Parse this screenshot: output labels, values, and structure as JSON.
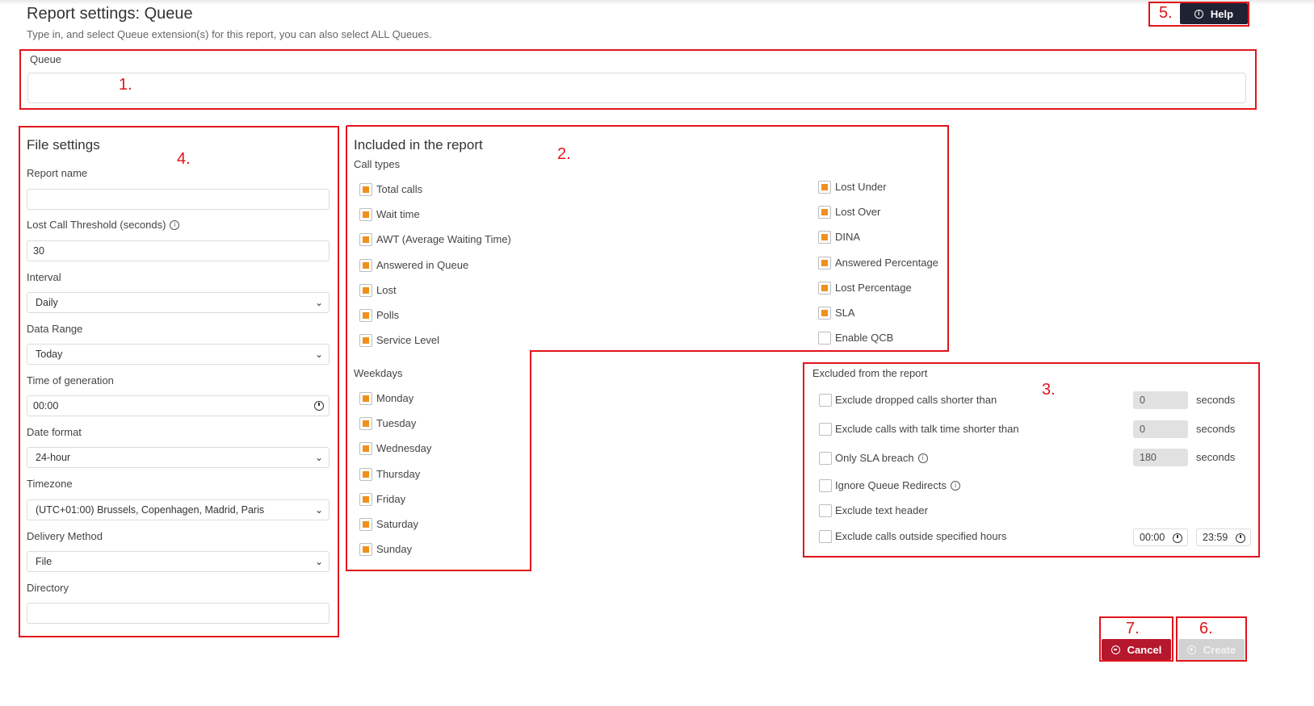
{
  "header": {
    "title": "Report settings: Queue",
    "subtitle": "Type in, and select Queue extension(s) for this report, you can also select ALL Queues.",
    "help_label": "Help",
    "help_icon": "info-icon"
  },
  "queue": {
    "label": "Queue",
    "value": ""
  },
  "annotations": {
    "a1": "1.",
    "a2": "2.",
    "a3": "3.",
    "a4": "4.",
    "a5": "5.",
    "a6": "6.",
    "a7": "7."
  },
  "file_settings": {
    "title": "File settings",
    "report_name_label": "Report name",
    "report_name_value": "",
    "lost_threshold_label": "Lost Call Threshold (seconds)",
    "lost_threshold_value": "30",
    "interval_label": "Interval",
    "interval_value": "Daily",
    "data_range_label": "Data Range",
    "data_range_value": "Today",
    "time_gen_label": "Time of generation",
    "time_gen_value": "00:00",
    "date_format_label": "Date format",
    "date_format_value": "24-hour",
    "timezone_label": "Timezone",
    "timezone_value": "(UTC+01:00) Brussels, Copenhagen, Madrid, Paris",
    "delivery_label": "Delivery Method",
    "delivery_value": "File",
    "directory_label": "Directory",
    "directory_value": ""
  },
  "included": {
    "title": "Included in the report",
    "call_types_label": "Call types",
    "call_types_left": [
      {
        "label": "Total calls",
        "checked": true
      },
      {
        "label": "Wait time",
        "checked": true
      },
      {
        "label": "AWT (Average Waiting Time)",
        "checked": true
      },
      {
        "label": "Answered in Queue",
        "checked": true
      },
      {
        "label": "Lost",
        "checked": true
      },
      {
        "label": "Polls",
        "checked": true
      },
      {
        "label": "Service Level",
        "checked": true
      }
    ],
    "call_types_right": [
      {
        "label": "Lost Under",
        "checked": true
      },
      {
        "label": "Lost Over",
        "checked": true
      },
      {
        "label": "DINA",
        "checked": true
      },
      {
        "label": "Answered Percentage",
        "checked": true
      },
      {
        "label": "Lost Percentage",
        "checked": true
      },
      {
        "label": "SLA",
        "checked": true
      },
      {
        "label": "Enable QCB",
        "checked": false
      }
    ],
    "weekdays_label": "Weekdays",
    "weekdays": [
      {
        "label": "Monday",
        "checked": true
      },
      {
        "label": "Tuesday",
        "checked": true
      },
      {
        "label": "Wednesday",
        "checked": true
      },
      {
        "label": "Thursday",
        "checked": true
      },
      {
        "label": "Friday",
        "checked": true
      },
      {
        "label": "Saturday",
        "checked": true
      },
      {
        "label": "Sunday",
        "checked": true
      }
    ]
  },
  "excluded": {
    "title": "Excluded from the report",
    "dropped_label": "Exclude dropped calls shorter than",
    "dropped_value": "0",
    "talk_label": "Exclude calls with talk time shorter than",
    "talk_value": "0",
    "sla_label": "Only SLA breach",
    "sla_value": "180",
    "unit": "seconds",
    "redirects_label": "Ignore Queue Redirects",
    "text_header_label": "Exclude text header",
    "outside_label": "Exclude calls outside specified hours",
    "from_time": "00:00",
    "to_time": "23:59"
  },
  "actions": {
    "cancel_label": "Cancel",
    "create_label": "Create"
  },
  "colors": {
    "accent": "#f0901c",
    "cancel": "#b5172c",
    "help": "#1e2233",
    "create": "#cfcfcf",
    "annotation": "#e3141b"
  }
}
